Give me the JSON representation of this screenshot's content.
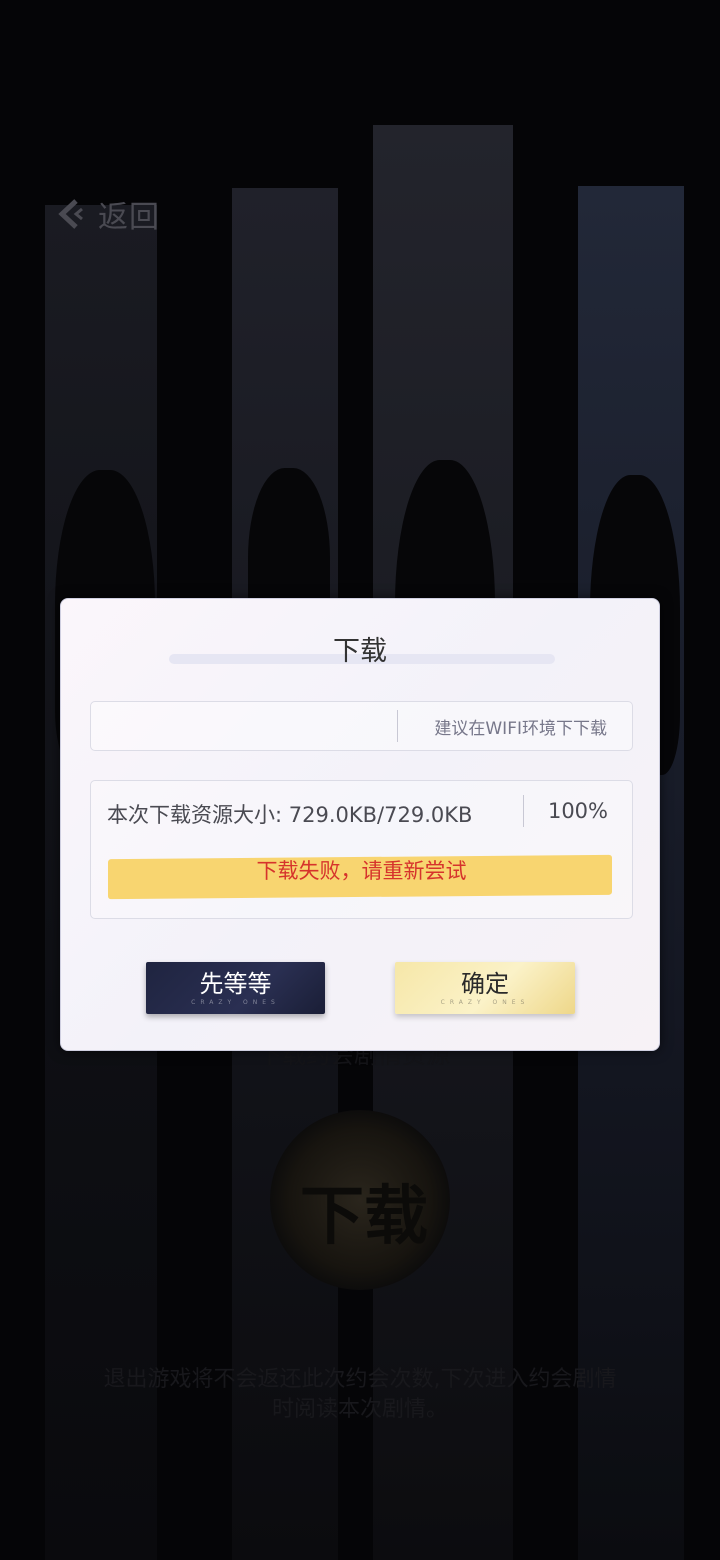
{
  "background": {
    "back_label": "返回",
    "behind_title": "下载约会剧情资源",
    "badge_label": "下载",
    "note": "退出游戏将不会返还此次约会次数,下次进入约会剧情时阅读本次剧情。"
  },
  "dialog": {
    "title": "下载",
    "wifi_hint": "建议在WIFI环境下下载",
    "size_label": "本次下载资源大小: 729.0KB/729.0KB",
    "percent": "100%",
    "progress_fraction": 1.0,
    "error_message": "下载失败，请重新尝试",
    "wait_button": {
      "label": "先等等",
      "sub": "CRAZY ONES"
    },
    "ok_button": {
      "label": "确定",
      "sub": "CRAZY ONES"
    }
  },
  "colors": {
    "error_text": "#d6332c",
    "progress_fill": "#f8d570",
    "wait_button_bg": "#1f2440",
    "ok_button_bg": "#f6e7a8"
  },
  "icons": {
    "back": "back-arrow-icon"
  }
}
